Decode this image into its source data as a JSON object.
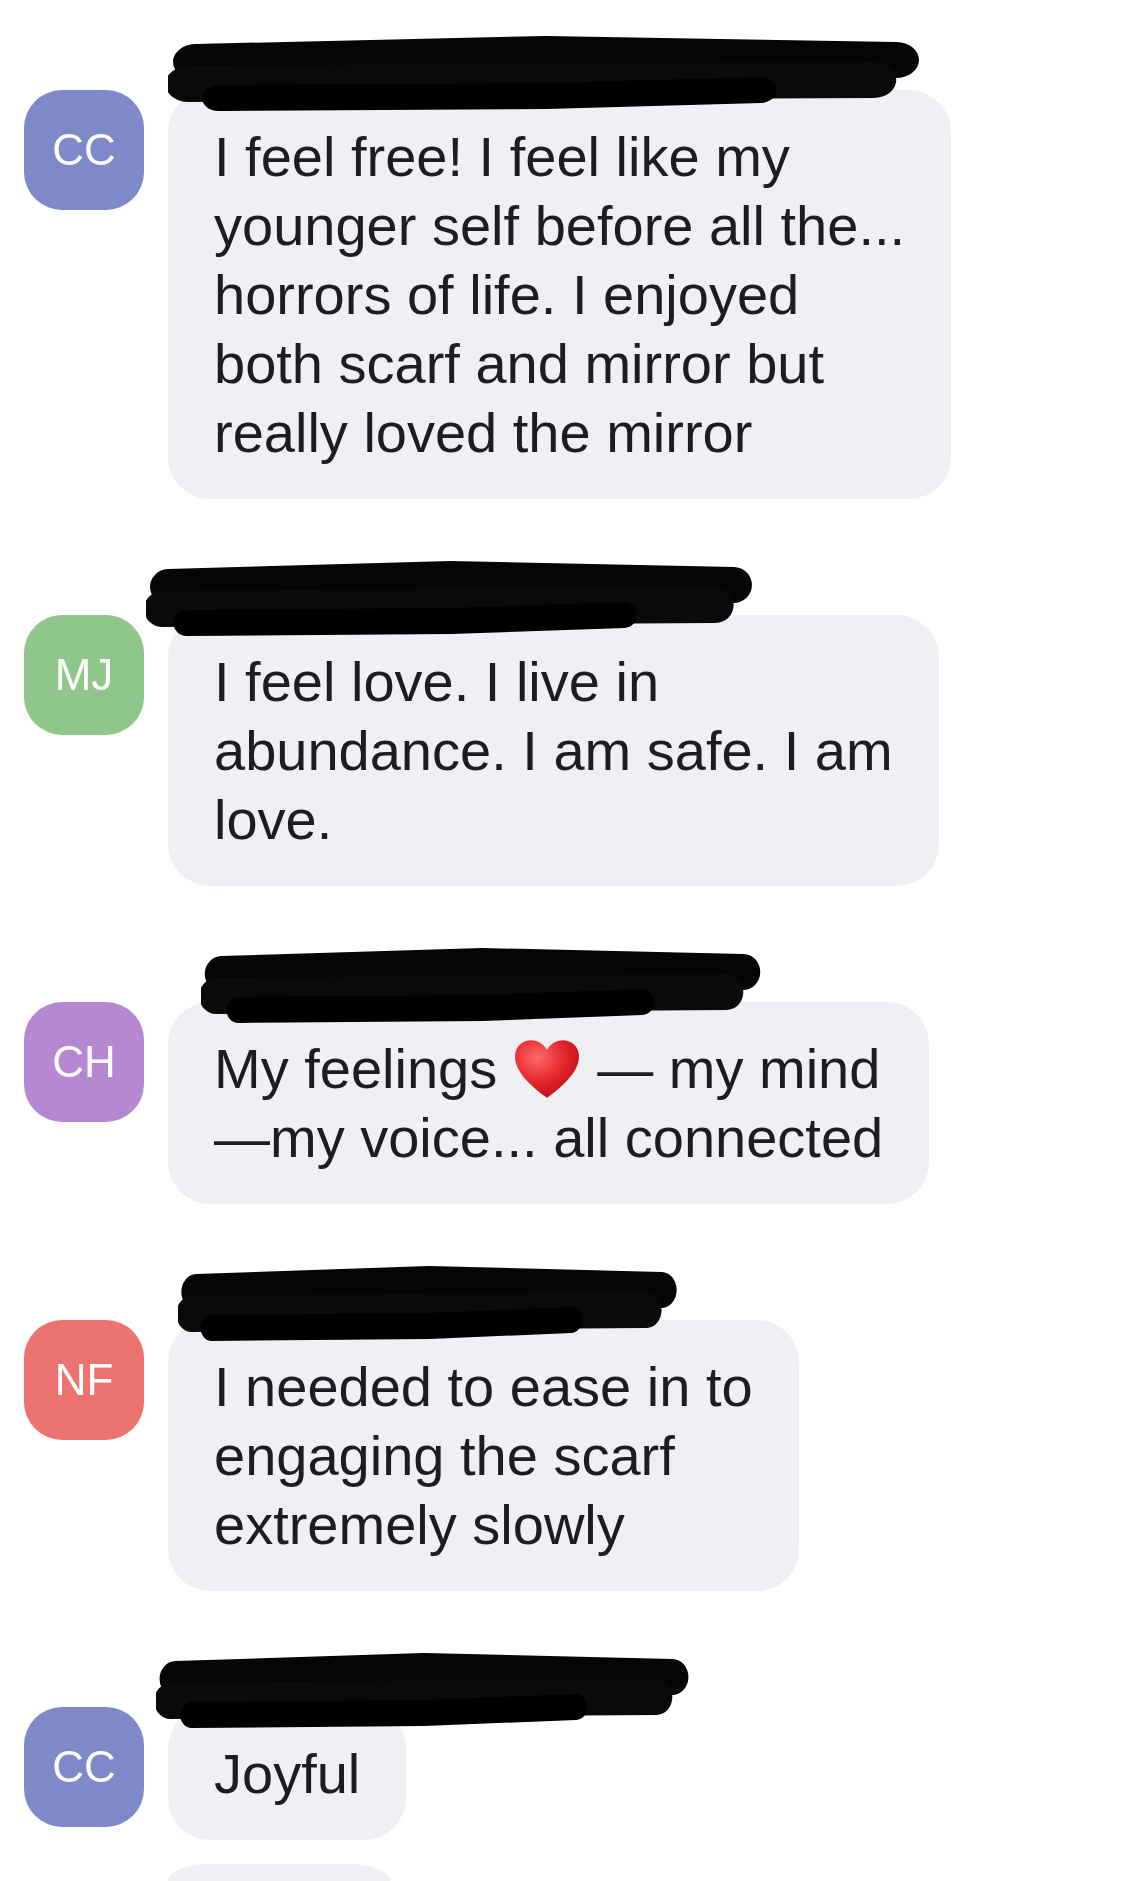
{
  "messages": [
    {
      "kind": "text",
      "redacted": true,
      "avatar": {
        "initials": "CC",
        "color": "#7f88c8"
      },
      "lines": [
        "I feel free! I feel like my",
        "younger self before all the...",
        "horrors of life. I enjoyed",
        "both scarf and mirror but",
        "really loved the mirror"
      ]
    },
    {
      "kind": "text",
      "redacted": true,
      "avatar": {
        "initials": "MJ",
        "color": "#8fc68b"
      },
      "lines": [
        "I feel love. I live in",
        "abundance. I am safe. I am",
        "love."
      ]
    },
    {
      "kind": "mixed",
      "redacted": true,
      "avatar": {
        "initials": "CH",
        "color": "#b688d2"
      },
      "rows": [
        [
          {
            "kind": "text",
            "text": "My feelings"
          },
          {
            "kind": "emoji"
          },
          {
            "kind": "text",
            "text": "— my mind"
          }
        ],
        [
          {
            "kind": "text",
            "text": "—my voice... all connected"
          }
        ]
      ]
    },
    {
      "kind": "text",
      "redacted": true,
      "avatar": {
        "initials": "NF",
        "color": "#ec736f"
      },
      "lines": [
        "I needed to ease in to",
        "engaging the scarf",
        "extremely slowly"
      ]
    },
    {
      "kind": "text",
      "redacted": true,
      "avatar": {
        "initials": "CC",
        "color": "#7f88c8"
      },
      "lines": [
        "Joyful"
      ]
    },
    {
      "kind": "cut_off"
    }
  ]
}
